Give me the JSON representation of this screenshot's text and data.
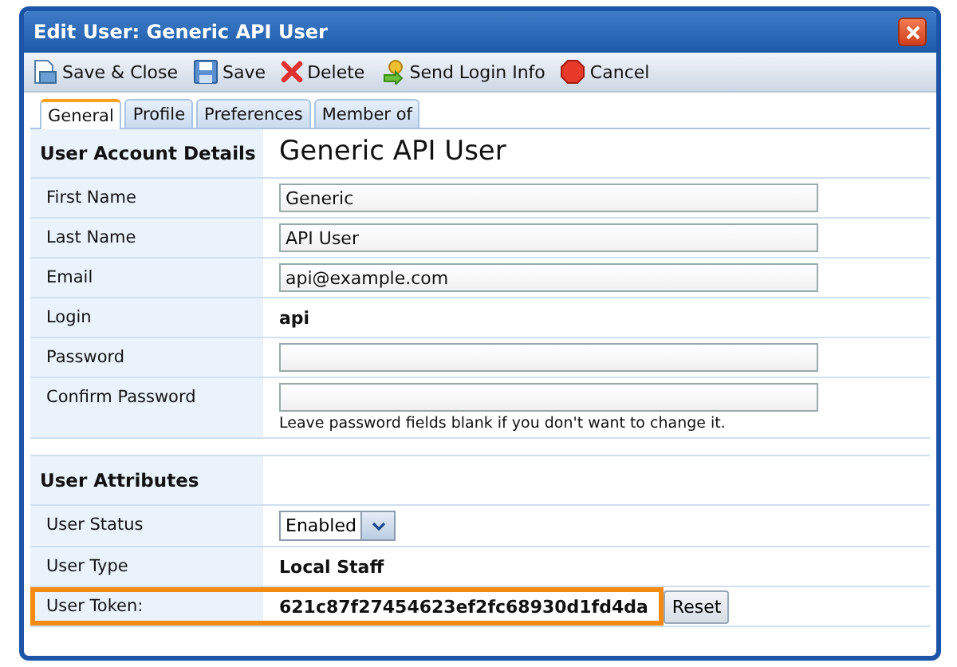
{
  "window": {
    "title": "Edit User: Generic API User"
  },
  "toolbar": [
    {
      "label": "Save & Close",
      "kind": "save-close"
    },
    {
      "label": "Save",
      "kind": "save"
    },
    {
      "label": "Delete",
      "kind": "delete"
    },
    {
      "label": "Send Login Info",
      "kind": "send"
    },
    {
      "label": "Cancel",
      "kind": "cancel"
    }
  ],
  "tabs": [
    {
      "label": "General",
      "selected": true
    },
    {
      "label": "Profile",
      "selected": false
    },
    {
      "label": "Preferences",
      "selected": false
    },
    {
      "label": "Member of",
      "selected": false
    }
  ],
  "account": {
    "heading": "User Account Details",
    "title": "Generic API User",
    "fields": [
      {
        "label": "First Name",
        "kind": "text",
        "value": "Generic"
      },
      {
        "label": "Last Name",
        "kind": "text",
        "value": "API User"
      },
      {
        "label": "Email",
        "kind": "text",
        "value": "api@example.com"
      },
      {
        "label": "Login",
        "kind": "static",
        "value": "api"
      },
      {
        "label": "Password",
        "kind": "text"
      },
      {
        "label": "Confirm Password",
        "kind": "text",
        "hint": "Leave password fields blank if you don't want to change it."
      }
    ]
  },
  "attributes": {
    "heading": "User Attributes",
    "fields": [
      {
        "label": "User Status",
        "kind": "select",
        "value": "Enabled",
        "highlighted": false
      },
      {
        "label": "User Type",
        "kind": "static",
        "value": "Local Staff",
        "highlighted": false
      },
      {
        "label": "User Token:",
        "kind": "token",
        "value": "621c87f27454623ef2fc68930d1fd4da",
        "button": "Reset",
        "highlighted": true
      }
    ]
  }
}
